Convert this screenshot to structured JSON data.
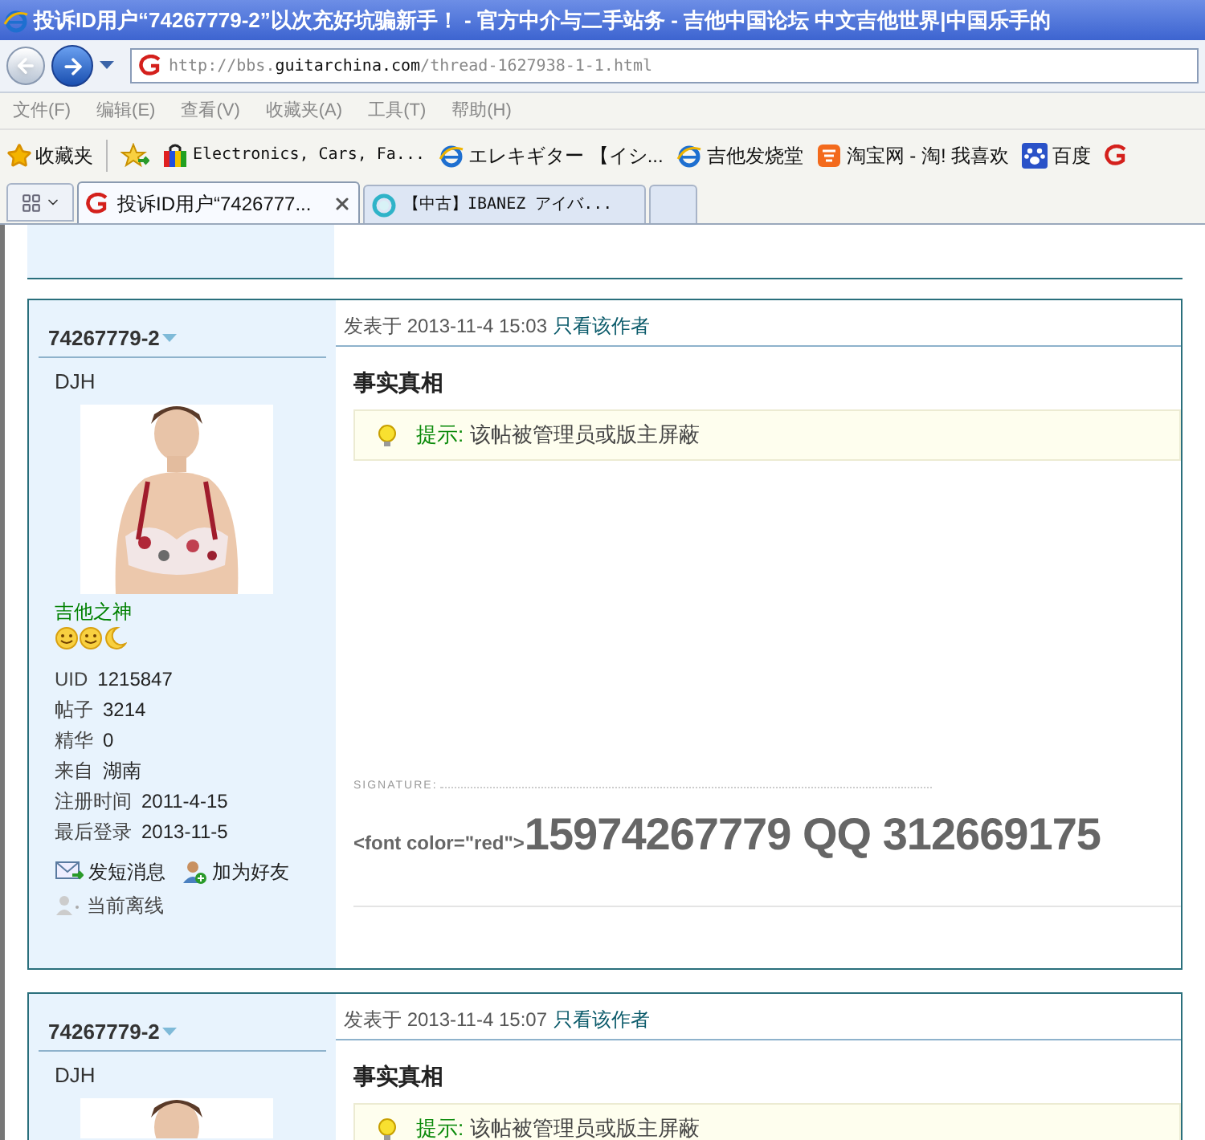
{
  "window": {
    "title": "投诉ID用户“74267779-2”以次充好坑骗新手！ - 官方中介与二手站务 - 吉他中国论坛 中文吉他世界|中国乐手的"
  },
  "address": {
    "prefix": "http://bbs.",
    "domain": "guitarchina.com",
    "path": "/thread-1627938-1-1.html"
  },
  "menu": [
    "文件(F)",
    "编辑(E)",
    "查看(V)",
    "收藏夹(A)",
    "工具(T)",
    "帮助(H)"
  ],
  "favorites": {
    "label": "收藏夹",
    "items": [
      {
        "kind": "shop",
        "label": "Electronics, Cars, Fa..."
      },
      {
        "kind": "ie",
        "label": "エレキギター 【イシ..."
      },
      {
        "kind": "ie",
        "label": "吉他发烧堂"
      },
      {
        "kind": "taobao",
        "label": "淘宝网 - 淘! 我喜欢"
      },
      {
        "kind": "paw",
        "label": "百度"
      },
      {
        "kind": "guitar"
      }
    ]
  },
  "tabs": [
    {
      "label": "投诉ID用户“7426777...",
      "selected": true,
      "kind": "guitar"
    },
    {
      "label": "【中古】IBANEZ アイバ...",
      "selected": false,
      "kind": "loading"
    }
  ],
  "posts": [
    {
      "author": "74267779-2",
      "nickname": "DJH",
      "group": "吉他之神",
      "stats": [
        {
          "label": "UID",
          "value": "1215847"
        },
        {
          "label": "帖子",
          "value": "3214"
        },
        {
          "label": "精华",
          "value": "0"
        },
        {
          "label": "来自",
          "value": "湖南"
        },
        {
          "label": "注册时间",
          "value": "2011-4-15"
        },
        {
          "label": "最后登录",
          "value": "2013-11-5"
        }
      ],
      "actions": [
        "发短消息",
        "加为好友"
      ],
      "online_status": "当前离线",
      "date": "发表于 2013-11-4 15:03",
      "author_only": "只看该作者",
      "title": "事实真相",
      "notice_label": "提示:",
      "notice": "该帖被管理员或版主屏蔽",
      "signature_label": "SIGNATURE:",
      "signature_prefix": "<font color=\"red\">",
      "signature": "15974267779 QQ 312669175"
    },
    {
      "author": "74267779-2",
      "nickname": "DJH",
      "date": "发表于 2013-11-4 15:07",
      "author_only": "只看该作者",
      "title": "事实真相",
      "notice_label": "提示:",
      "notice": "该帖被管理员或版主屏蔽"
    }
  ]
}
